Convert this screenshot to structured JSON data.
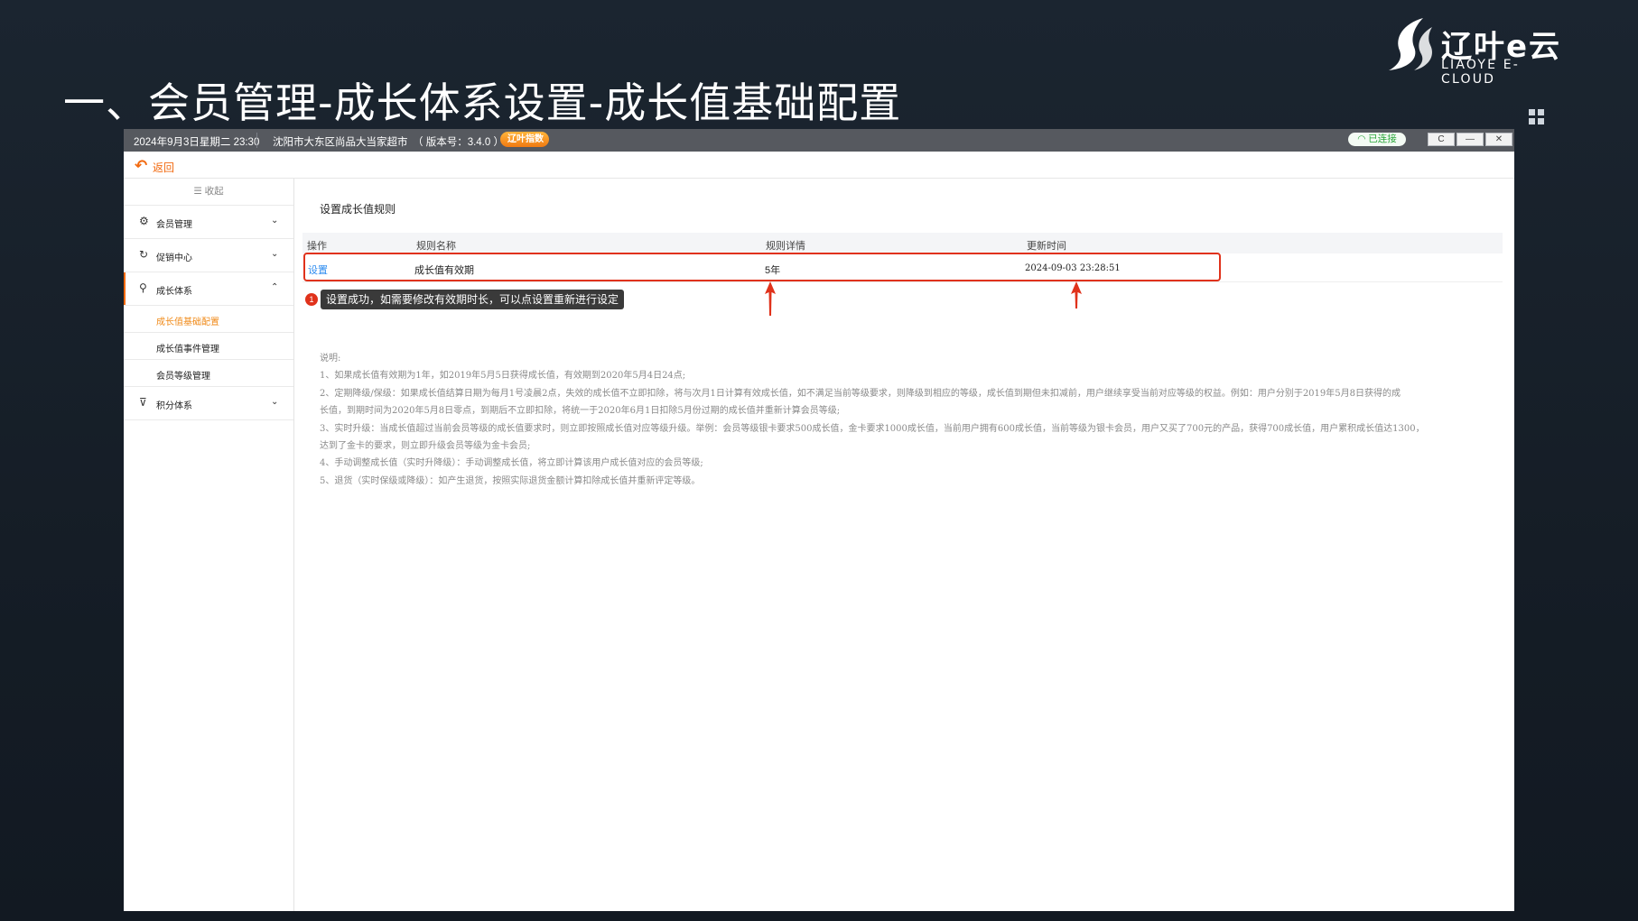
{
  "slide": {
    "title": "一、会员管理-成长体系设置-成长值基础配置",
    "logo_main": "辽叶e云",
    "logo_sub": "LIAOYE E-CLOUD"
  },
  "titlebar": {
    "datetime": "2024年9月3日星期二 23:30",
    "store": "沈阳市大东区尚品大当家超市",
    "version": "（ 版本号：3.4.0 ）",
    "badge": "辽叶指数",
    "connection": "已连接",
    "refresh_btn": "C",
    "minimize_btn": "—",
    "close_btn": "✕"
  },
  "backbar": {
    "label": "返回"
  },
  "sidebar": {
    "collapse_label": "☰ 收起",
    "items": [
      {
        "label": "会员管理",
        "icon": "gear-icon",
        "glyph": "⚙",
        "chevron": "⌄"
      },
      {
        "label": "促销中心",
        "icon": "refresh-icon",
        "glyph": "↻",
        "chevron": "⌄"
      },
      {
        "label": "成长体系",
        "icon": "growth-icon",
        "glyph": "⚲",
        "chevron": "⌃"
      },
      {
        "label": "积分体系",
        "icon": "filter-icon",
        "glyph": "⊽",
        "chevron": "⌄"
      }
    ],
    "sub_items": [
      {
        "label": "成长值基础配置",
        "active": true
      },
      {
        "label": "成长值事件管理",
        "active": false
      },
      {
        "label": "会员等级管理",
        "active": false
      }
    ]
  },
  "main": {
    "panel_title": "设置成长值规则",
    "columns": [
      "操作",
      "规则名称",
      "规则详情",
      "更新时间"
    ],
    "row": {
      "action": "设置",
      "name": "成长值有效期",
      "detail": "5年",
      "updated": "2024-09-03 23:28:51"
    },
    "tip_number": "1",
    "tip_text": "设置成功，如需要修改有效期时长，可以点设置重新进行设定",
    "notes": [
      "说明:",
      "1、如果成长值有效期为1年，如2019年5月5日获得成长值，有效期到2020年5月4日24点;",
      "2、定期降级/保级：如果成长值结算日期为每月1号凌晨2点，失效的成长值不立即扣除，将与次月1日计算有效成长值，如不满足当前等级要求，则降级到相应的等级，成长值到期但未扣减前，用户继续享受当前对应等级的权益。例如：用户分别于2019年5月8日获得的成",
      "长值，到期时间为2020年5月8日零点，到期后不立即扣除，将统一于2020年6月1日扣除5月份过期的成长值并重新计算会员等级;",
      "3、实时升级：当成长值超过当前会员等级的成长值要求时，则立即按照成长值对应等级升级。举例：会员等级银卡要求500成长值，金卡要求1000成长值，当前用户拥有600成长值，当前等级为银卡会员，用户又买了700元的产品，获得700成长值，用户累积成长值达1300，",
      "达到了金卡的要求，则立即升级会员等级为金卡会员;",
      "4、手动调整成长值（实时升降级）：手动调整成长值，将立即计算该用户成长值对应的会员等级;",
      "5、退货（实时保级或降级）：如产生退货，按照实际退货金额计算扣除成长值并重新评定等级。"
    ]
  },
  "colors": {
    "accent": "#f26a10",
    "highlight": "#e0321b",
    "link": "#2d8cf0",
    "slide_bg": "#1b2530"
  }
}
